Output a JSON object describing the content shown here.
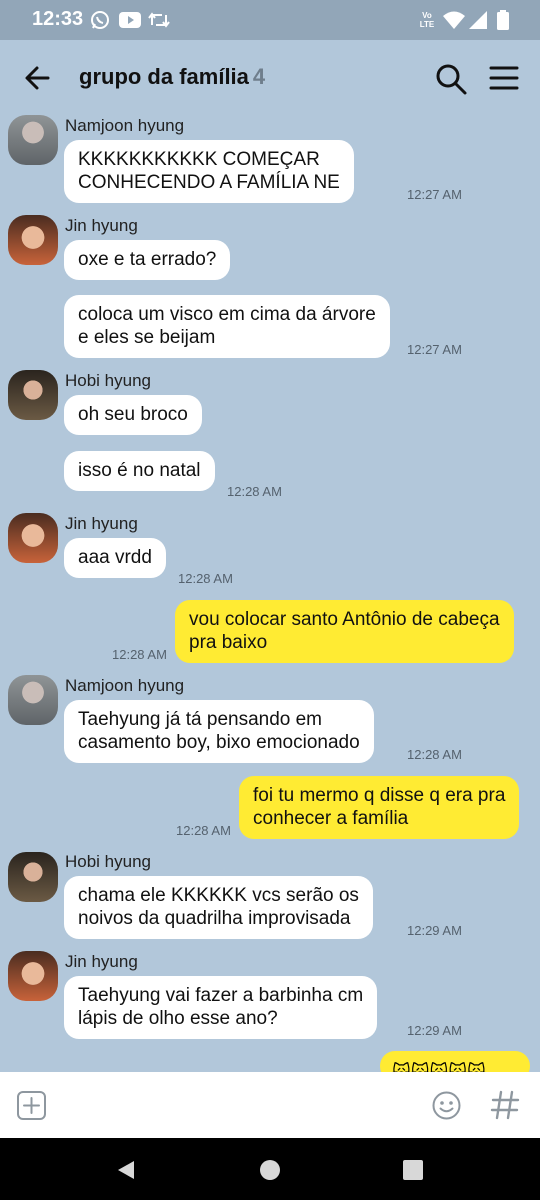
{
  "status_bar": {
    "time": "12:33",
    "left_icons": [
      "whatsapp-icon",
      "youtube-icon",
      "retweet-icon"
    ],
    "right_icons": [
      "volte-icon",
      "wifi-icon",
      "signal-icon",
      "battery-icon"
    ],
    "volte_line1": "Vo",
    "volte_line2": "LTE"
  },
  "header": {
    "title": "grupo da família",
    "member_count": "4",
    "icons": [
      "back-arrow-icon",
      "search-icon",
      "hamburger-menu-icon"
    ]
  },
  "colors": {
    "chat_background": "#b2c7da",
    "incoming_bubble": "#ffffff",
    "outgoing_bubble": "#ffeb33",
    "status_bar": "#92a6b8"
  },
  "messages": [
    {
      "sender": "Namjoon hyung",
      "text": [
        "KKKKKKKKKKK COMEÇAR",
        "CONHECENDO A FAMÍLIA NE"
      ],
      "time": "12:27 AM"
    },
    {
      "sender": "Jin hyung",
      "text": [
        "oxe e ta errado?"
      ]
    },
    {
      "text": [
        "coloca um visco em cima da árvore",
        "e eles se beijam"
      ],
      "time": "12:27 AM"
    },
    {
      "sender": "Hobi hyung",
      "text": [
        "oh seu broco"
      ]
    },
    {
      "text": [
        "isso é no natal"
      ],
      "time": "12:28 AM"
    },
    {
      "sender": "Jin hyung",
      "text": [
        "aaa vrdd"
      ],
      "time": "12:28 AM"
    },
    {
      "text": [
        "vou colocar santo Antônio de cabeça",
        "pra baixo"
      ],
      "time": "12:28 AM"
    },
    {
      "sender": "Namjoon hyung",
      "text": [
        "Taehyung já tá pensando em",
        "casamento boy, bixo emocionado"
      ],
      "time": "12:28 AM"
    },
    {
      "text": [
        "foi tu mermo q disse q era pra",
        "conhecer a família"
      ],
      "time": "12:28 AM"
    },
    {
      "sender": "Hobi hyung",
      "text": [
        "chama ele KKKKKK vcs serão os",
        "noivos da quadrilha improvisada"
      ],
      "time": "12:29 AM"
    },
    {
      "sender": "Jin hyung",
      "text": [
        "Taehyung vai fazer a barbinha cm",
        "lápis de olho esse ano?"
      ],
      "time": "12:29 AM"
    },
    {
      "text": [
        "🙀🙀🙀🙀🙀"
      ]
    }
  ],
  "input_bar": {
    "icons": [
      "plus-box-icon",
      "emoji-icon",
      "hashtag-icon"
    ]
  },
  "nav_bar": {
    "icons": [
      "back-triangle-icon",
      "home-circle-icon",
      "recents-square-icon"
    ]
  }
}
